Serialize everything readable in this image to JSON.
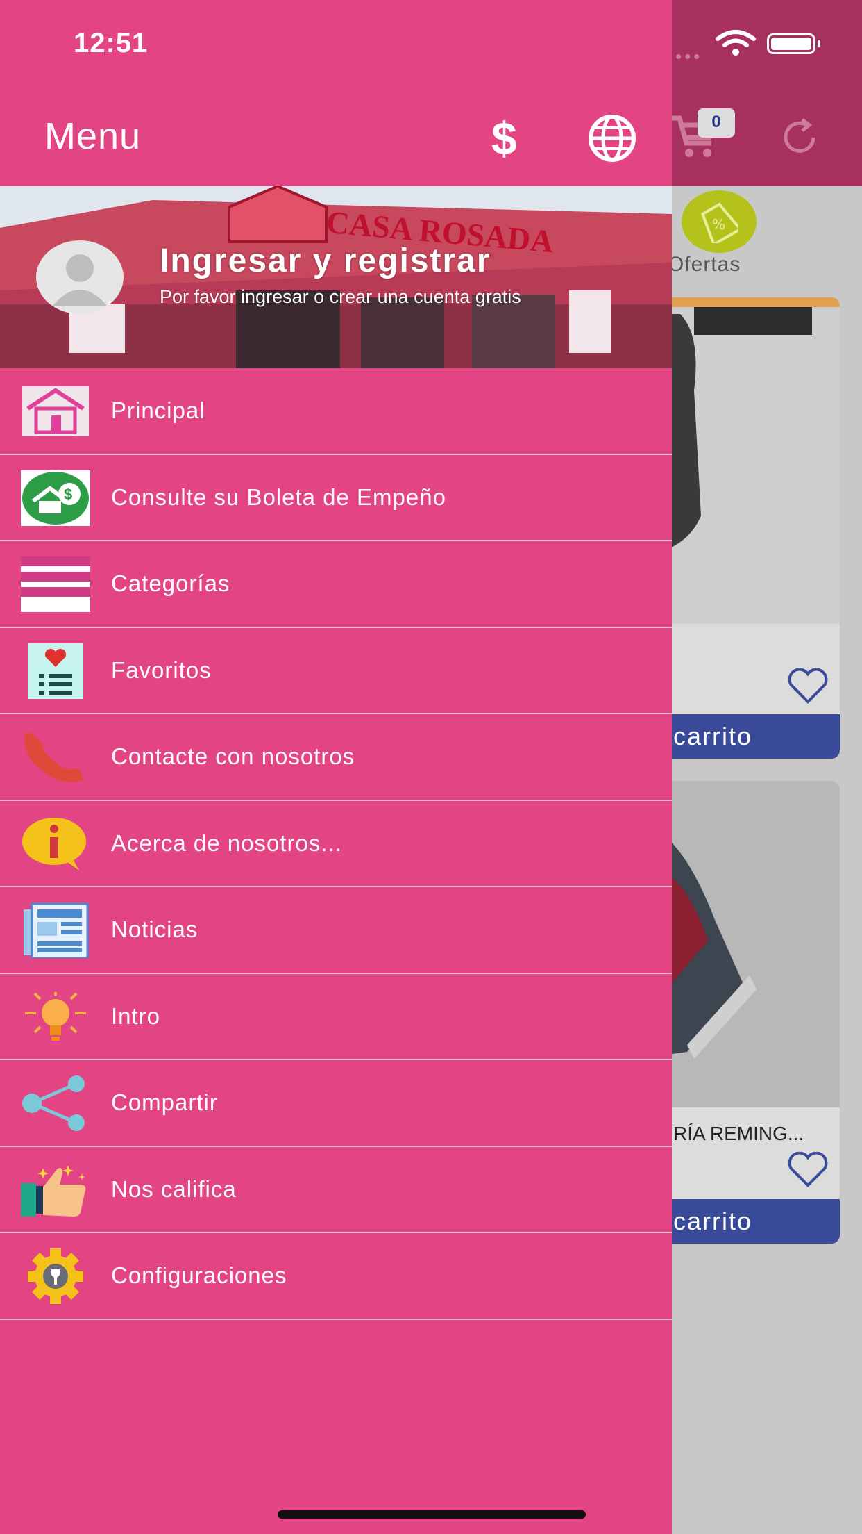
{
  "status_bar": {
    "time": "12:51"
  },
  "drawer": {
    "title": "Menu",
    "currency_icon": "dollar-icon",
    "language_icon": "globe-icon",
    "profile": {
      "title": "Ingresar y registrar",
      "subtitle": "Por favor ingresar o crear una cuenta gratis",
      "banner_sign": "CASA ROSADA"
    },
    "items": [
      {
        "label": "Principal",
        "icon": "home-icon"
      },
      {
        "label": "Consulte su Boleta de Empeño",
        "icon": "pawn-ticket-icon"
      },
      {
        "label": "Categorías",
        "icon": "categories-icon"
      },
      {
        "label": "Favoritos",
        "icon": "favorites-icon"
      },
      {
        "label": "Contacte con nosotros",
        "icon": "phone-icon"
      },
      {
        "label": "Acerca de nosotros...",
        "icon": "info-icon"
      },
      {
        "label": "Noticias",
        "icon": "news-icon"
      },
      {
        "label": "Intro",
        "icon": "lightbulb-icon"
      },
      {
        "label": "Compartir",
        "icon": "share-icon"
      },
      {
        "label": "Nos califica",
        "icon": "thumbs-up-icon"
      },
      {
        "label": "Configuraciones",
        "icon": "settings-gear-icon"
      }
    ]
  },
  "background": {
    "cart_count": "0",
    "offers_label": "Ofertas",
    "cards": [
      {
        "title": "",
        "button": "carrito"
      },
      {
        "title": "RÍA REMING...",
        "button": "carrito"
      }
    ]
  },
  "colors": {
    "drawer": "#e34584",
    "header_dim": "#a8305e",
    "cart_button": "#384a98",
    "offer_badge": "#b4c21b"
  }
}
